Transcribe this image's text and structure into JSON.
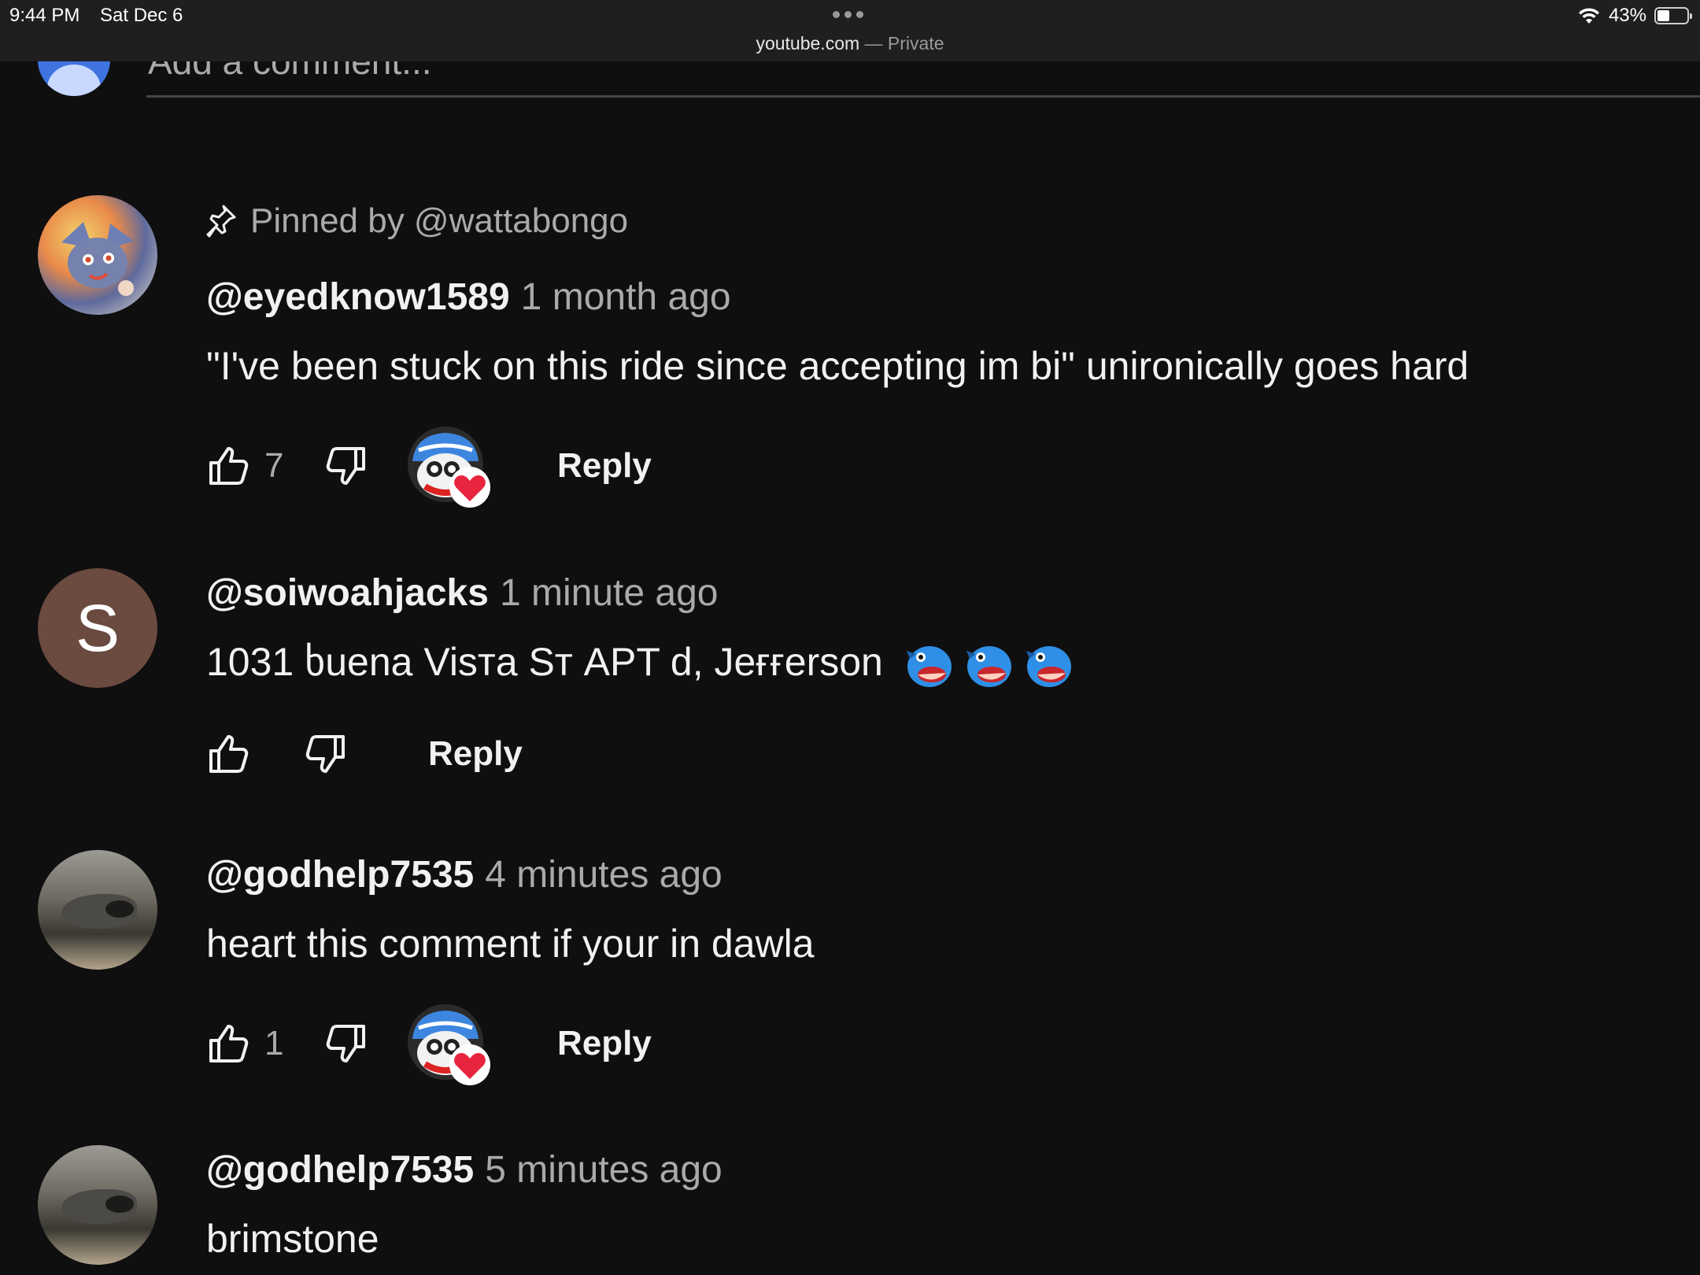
{
  "status_bar": {
    "time": "9:44 PM",
    "date": "Sat Dec 6",
    "url_host": "youtube.com",
    "url_suffix": " — Private",
    "battery": "43%",
    "battery_level": 0.43
  },
  "add_comment": {
    "placeholder": "Add a comment..."
  },
  "comments": [
    {
      "pinned_label": "Pinned by @wattabongo",
      "handle": "@eyedknow1589",
      "time": "1 month ago",
      "text": "\"I've been stuck on this ride since accepting im bi\" unironically goes hard",
      "likes": "7",
      "creator_heart": true,
      "reply_label": "Reply"
    },
    {
      "avatar_letter": "S",
      "handle": "@soiwoahjacks",
      "time": "1 minute ago",
      "text": "1031 ხuena Visтa Sт APT d, Jeғғerson",
      "emoji_count": 3,
      "likes": "",
      "creator_heart": false,
      "reply_label": "Reply"
    },
    {
      "handle": "@godhelp7535",
      "time": "4 minutes ago",
      "text": "heart this comment if your in dawla",
      "likes": "1",
      "creator_heart": true,
      "reply_label": "Reply"
    },
    {
      "handle": "@godhelp7535",
      "time": "5 minutes ago",
      "text": "brimstone"
    }
  ],
  "colors": {
    "background": "#0f0f0f",
    "status_bar": "#1f1f1f",
    "secondary_text": "#aaaaaa",
    "heart": "#e8253f",
    "avatar_s": "#6b4a3f"
  }
}
